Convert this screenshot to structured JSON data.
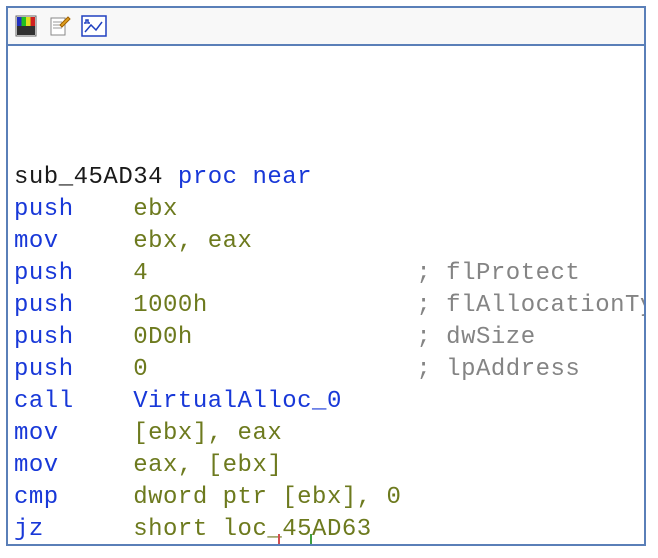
{
  "toolbar": {
    "icons": [
      "palette-icon",
      "edit-note-icon",
      "graph-icon"
    ]
  },
  "code": {
    "header": {
      "label": "sub_45AD34",
      "decl": " proc near"
    },
    "lines": [
      {
        "mn": "push",
        "op": "ebx",
        "opClass": "c-olive",
        "cm": ""
      },
      {
        "mn": "mov",
        "op": "ebx, eax",
        "opClass": "c-olive",
        "cm": ""
      },
      {
        "mn": "push",
        "op": "4",
        "opClass": "c-olive",
        "cm": "; flProtect"
      },
      {
        "mn": "push",
        "op": "1000h",
        "opClass": "c-olive",
        "cm": "; flAllocationType"
      },
      {
        "mn": "push",
        "op": "0D0h",
        "opClass": "c-olive",
        "cm": "; dwSize"
      },
      {
        "mn": "push",
        "op": "0",
        "opClass": "c-olive",
        "cm": "; lpAddress"
      },
      {
        "mn": "call",
        "op": "VirtualAlloc_0",
        "opClass": "c-blue",
        "cm": ""
      },
      {
        "mn": "mov",
        "op": "[ebx], eax",
        "opClass": "c-olive",
        "cm": ""
      },
      {
        "mn": "mov",
        "op": "eax, [ebx]",
        "opClass": "c-olive",
        "cm": ""
      },
      {
        "mn": "cmp",
        "op": "dword ptr [ebx], 0",
        "opClass": "c-olive",
        "cm": ""
      },
      {
        "mn": "jz",
        "op": "short loc_45AD63",
        "opClass": "c-olive",
        "cm": ""
      }
    ]
  },
  "columns": {
    "mnemonicWidth": 8,
    "operandWidth": 19
  }
}
